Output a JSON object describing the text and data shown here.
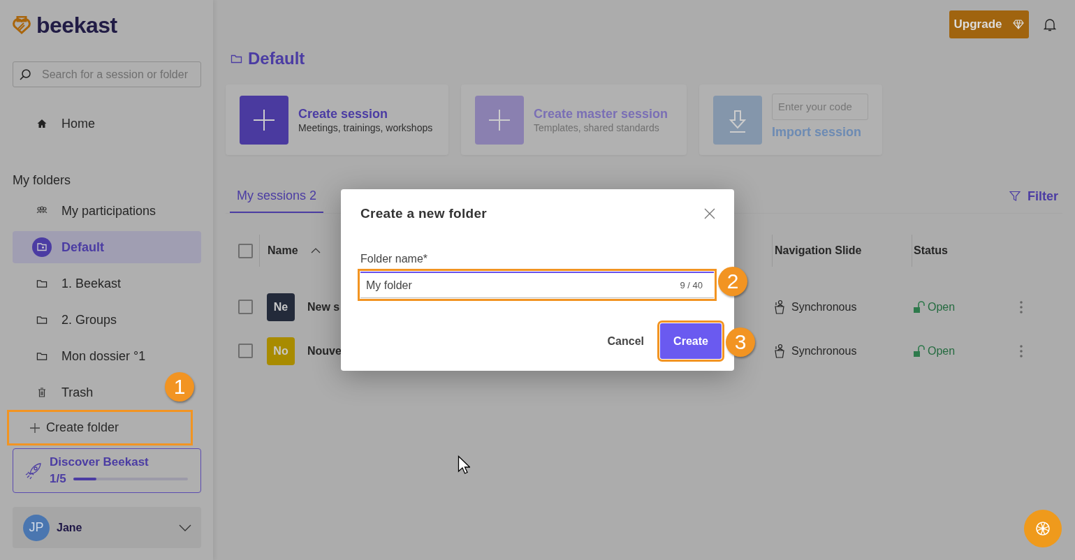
{
  "logo": {
    "text": "beekast"
  },
  "sidebar": {
    "search": {
      "placeholder": "Search for a session or folder"
    },
    "home": {
      "label": "Home"
    },
    "section_title": "My folders",
    "items": [
      {
        "label": "My participations",
        "kind": "participations",
        "selected": false
      },
      {
        "label": "Default",
        "kind": "default",
        "selected": true
      },
      {
        "label": "1. Beekast",
        "kind": "folder",
        "selected": false
      },
      {
        "label": "2. Groups",
        "kind": "folder",
        "selected": false
      },
      {
        "label": "Mon dossier °1",
        "kind": "folder",
        "selected": false
      },
      {
        "label": "Trash",
        "kind": "trash",
        "selected": false
      }
    ],
    "create_folder": "Create folder",
    "discover": {
      "title": "Discover Beekast",
      "progress": "1/5",
      "level": 0.2
    },
    "user": {
      "initials": "JP",
      "name": "Jane"
    }
  },
  "header": {
    "upgrade": "Upgrade"
  },
  "page_title": "Default",
  "action_cards": [
    {
      "kind": "create",
      "title": "Create session",
      "subtitle": "Meetings, trainings, workshops",
      "disabled": false
    },
    {
      "kind": "create",
      "title": "Create master session",
      "subtitle": "Templates, shared standards",
      "disabled": true
    },
    {
      "kind": "import",
      "placeholder": "Enter your code",
      "title": "Import session",
      "disabled": true
    }
  ],
  "tabs": [
    {
      "label": "My sessions 2",
      "selected": true
    }
  ],
  "filter": "Filter",
  "table": {
    "select_all_checked": false,
    "columns": [
      {
        "label": "Name",
        "sorted": true
      },
      {
        "label": "Navigation Slide",
        "sorted": false
      },
      {
        "label": "Status",
        "sorted": false
      }
    ],
    "rows": [
      {
        "checked": false,
        "initials": "Ne",
        "color": "#232a3a",
        "name": "New s",
        "navigation": "Synchronous",
        "status": "Open"
      },
      {
        "checked": false,
        "initials": "No",
        "color": "#a88b00",
        "name": "Nouve",
        "navigation": "Synchronous",
        "status": "Open"
      }
    ]
  },
  "dialog": {
    "title": "Create a new folder",
    "field_label": "Folder name*",
    "value": "My folder",
    "counter": "9 / 40",
    "buttons": [
      {
        "label": "Cancel",
        "kind": "secondary"
      },
      {
        "label": "Create",
        "kind": "primary"
      }
    ]
  },
  "annotations": [
    {
      "number": "1"
    },
    {
      "number": "2"
    },
    {
      "number": "3"
    }
  ]
}
